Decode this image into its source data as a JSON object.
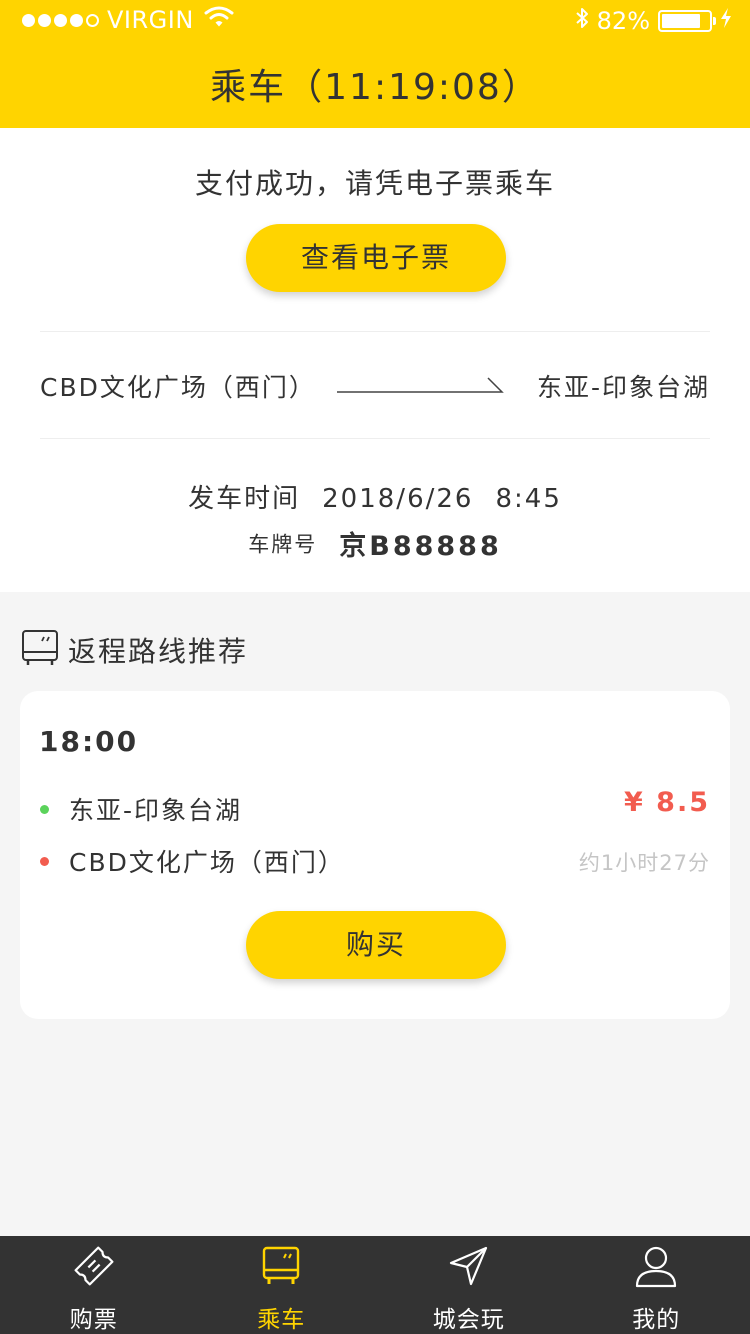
{
  "status_bar": {
    "carrier": "VIRGIN",
    "battery": "82%",
    "battery_level": 0.82
  },
  "nav": {
    "title": "乘车（11:19:08）"
  },
  "ticket": {
    "success_message": "支付成功，请凭电子票乘车",
    "view_ticket_label": "查看电子票",
    "route_from": "CBD文化广场（西门）",
    "route_to": "东亚-印象台湖",
    "depart_label": "发车时间",
    "depart_date": "2018/6/26",
    "depart_time": "8:45",
    "plate_label": "车牌号",
    "plate_value": "京B88888"
  },
  "return_section": {
    "title": "返程路线推荐",
    "card": {
      "time": "18:00",
      "start_stop": "东亚-印象台湖",
      "end_stop": "CBD文化广场（西门）",
      "price": "¥ 8.5",
      "duration": "约1小时27分",
      "buy_label": "购买"
    }
  },
  "tabbar": {
    "items": [
      {
        "label": "购票",
        "icon": "ticket-icon",
        "active": false
      },
      {
        "label": "乘车",
        "icon": "bus-icon",
        "active": true
      },
      {
        "label": "城会玩",
        "icon": "send-icon",
        "active": false
      },
      {
        "label": "我的",
        "icon": "user-icon",
        "active": false
      }
    ]
  },
  "colors": {
    "brand_yellow": "#ffd400",
    "price_red": "#f25c4f",
    "start_dot": "#5bd35b",
    "end_dot": "#f25c4f",
    "tabbar_bg": "#333333"
  }
}
